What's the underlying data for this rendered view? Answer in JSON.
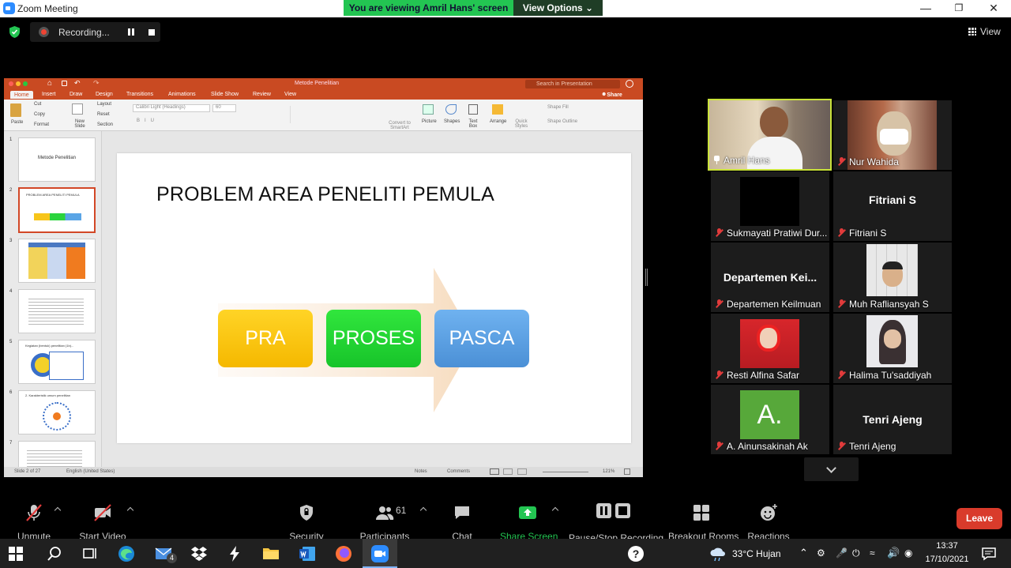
{
  "window": {
    "title": "Zoom Meeting",
    "viewing_banner": "You are viewing Amril Hans' screen",
    "view_options": "View Options ⌄"
  },
  "topbar": {
    "recording_label": "Recording...",
    "view_label": "View"
  },
  "shared": {
    "doc_title": "Metode Penelitian",
    "search_placeholder": "Search in Presentation",
    "share_label": "Share",
    "tabs": [
      "Home",
      "Insert",
      "Draw",
      "Design",
      "Transitions",
      "Animations",
      "Slide Show",
      "Review",
      "View"
    ],
    "ribbon": {
      "paste": "Paste",
      "cut": "Cut",
      "copy": "Copy",
      "format": "Format",
      "new_slide": "New Slide",
      "layout": "Layout",
      "reset": "Reset",
      "section": "Section",
      "font": "Calibri Light (Headings)",
      "font_size": "60",
      "convert": "Convert to SmartArt",
      "picture": "Picture",
      "shapes": "Shapes",
      "textbox": "Text Box",
      "arrange": "Arrange",
      "quick_styles": "Quick Styles",
      "shape_fill": "Shape Fill",
      "shape_outline": "Shape Outline"
    },
    "thumbs": [
      {
        "num": "1",
        "text": "Metode Penelitian"
      },
      {
        "num": "2",
        "text": "PROBLEM AREA PENELITI PEMULA"
      },
      {
        "num": "3",
        "text": ""
      },
      {
        "num": "4",
        "text": ""
      },
      {
        "num": "5",
        "text": "Kegiatan (bentuk) penelitian (1b)..."
      },
      {
        "num": "6",
        "text": "2. Karakteristik umum penelitian"
      },
      {
        "num": "7",
        "text": ""
      }
    ],
    "slide": {
      "title": "PROBLEM AREA PENELITI PEMULA",
      "steps": [
        "PRA",
        "PROSES",
        "PASCA"
      ]
    },
    "status": {
      "slide_info": "Slide 2 of 27",
      "language": "English (United States)",
      "notes": "Notes",
      "comments": "Comments",
      "zoom": "121%"
    }
  },
  "participants": [
    {
      "name": "Amril Hans",
      "display": "",
      "mic": "pinned"
    },
    {
      "name": "Nur Wahida",
      "display": "",
      "mic": "off"
    },
    {
      "name": "Sukmayati Pratiwi Dur...",
      "display": "",
      "mic": "off"
    },
    {
      "name": "Fitriani S",
      "display": "Fitriani S",
      "mic": "off"
    },
    {
      "name": "Departemen Keilmuan",
      "display": "Departemen Kei...",
      "mic": "off"
    },
    {
      "name": "Muh Rafliansyah S",
      "display": "",
      "mic": "off"
    },
    {
      "name": "Resti Alfina Safar",
      "display": "",
      "mic": "off"
    },
    {
      "name": "Halima Tu'saddiyah",
      "display": "",
      "mic": "off"
    },
    {
      "name": "A. Ainunsakinah Ak",
      "display": "A.",
      "mic": "off"
    },
    {
      "name": "Tenri Ajeng",
      "display": "Tenri Ajeng",
      "mic": "off"
    }
  ],
  "toolbar": {
    "unmute": "Unmute",
    "start_video": "Start Video",
    "security": "Security",
    "participants": "Participants",
    "participants_count": "61",
    "chat": "Chat",
    "share_screen": "Share Screen",
    "pause_recording": "Pause/Stop Recording",
    "breakout": "Breakout Rooms",
    "reactions": "Reactions",
    "leave": "Leave"
  },
  "taskbar": {
    "mail_badge": "4",
    "weather": "33°C  Hujan",
    "time": "13:37",
    "date": "17/10/2021"
  },
  "colors": {
    "accent": "#2d8cff",
    "share_green": "#23c552",
    "leave_red": "#d93b2b",
    "ppt_orange": "#c94a22",
    "active_speaker": "#c9e23a"
  }
}
